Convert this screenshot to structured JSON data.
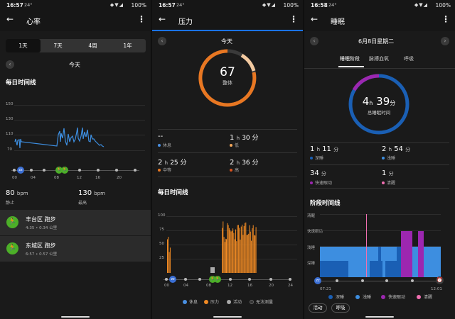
{
  "status": {
    "time1": "16:57",
    "time2": "16:57",
    "time3": "16:58",
    "temp": "24°",
    "battery": "100%"
  },
  "hr": {
    "title": "心率",
    "ranges": [
      "1天",
      "7天",
      "4周",
      "1年"
    ],
    "day": "今天",
    "timeline_title": "每日时间线",
    "ticks_y": [
      "150",
      "130",
      "110",
      "70"
    ],
    "ticks_x": [
      "00",
      "04",
      "08",
      "12",
      "16",
      "20"
    ],
    "rest_value": "80",
    "rest_unit": "bpm",
    "rest_label": "静止",
    "max_value": "130",
    "max_unit": "bpm",
    "max_label": "最高",
    "activities": [
      {
        "title": "丰台区 跑步",
        "sub": "4:35 • 0.34 公里"
      },
      {
        "title": "东城区 跑步",
        "sub": "6:57 • 0.57 公里"
      }
    ]
  },
  "stress": {
    "title": "压力",
    "day": "今天",
    "overall_value": "67",
    "overall_label": "整体",
    "stats": [
      {
        "value": "--",
        "h": "",
        "m": "",
        "label": "休息",
        "color": "#4a90e2"
      },
      {
        "value": "1",
        "h": "h",
        "m": "30 分",
        "label": "低",
        "color": "#f2a65a"
      },
      {
        "value": "2",
        "h": "h",
        "m": "25 分",
        "label": "中等",
        "color": "#e87722"
      },
      {
        "value": "2",
        "h": "h",
        "m": "36 分",
        "label": "高",
        "color": "#d9531e"
      }
    ],
    "timeline_title": "每日时间线",
    "ticks_y": [
      "100",
      "75",
      "50",
      "25"
    ],
    "ticks_x": [
      "00",
      "04",
      "08",
      "12",
      "16",
      "20",
      "24"
    ],
    "legend": [
      {
        "label": "休息",
        "color": "#4a90e2"
      },
      {
        "label": "压力",
        "color": "#f08a24"
      },
      {
        "label": "活动",
        "color": "#aaaaaa"
      },
      {
        "label": "无法测量",
        "color": "#333333"
      }
    ]
  },
  "sleep": {
    "title": "睡眠",
    "date": "6月8日星期二",
    "tabs": [
      "睡眠阶段",
      "脉搏血氧",
      "呼吸"
    ],
    "total_h": "4",
    "total_hu": "h",
    "total_m": "39",
    "total_mu": "分",
    "total_label": "总睡眠时间",
    "stats": [
      {
        "h": "1",
        "hu": "h",
        "m": "11",
        "mu": "分",
        "label": "深睡",
        "color": "#1a5fb4"
      },
      {
        "h": "2",
        "hu": "h",
        "m": "54",
        "mu": "分",
        "label": "浅睡",
        "color": "#3d8ee0"
      },
      {
        "h": "",
        "hu": "",
        "m": "34",
        "mu": "分",
        "label": "快速眼动",
        "color": "#9c27b0"
      },
      {
        "h": "",
        "hu": "",
        "m": "1",
        "mu": "分",
        "label": "清醒",
        "color": "#f06fb0"
      }
    ],
    "timeline_title": "阶段时间线",
    "levels": [
      "清醒",
      "快速眼动",
      "浅睡",
      "深睡"
    ],
    "start": "07:21",
    "end": "12:01",
    "legend": [
      {
        "label": "深睡",
        "color": "#1a5fb4"
      },
      {
        "label": "浅睡",
        "color": "#3d8ee0"
      },
      {
        "label": "快速眼动",
        "color": "#9c27b0"
      },
      {
        "label": "清醒",
        "color": "#f06fb0"
      }
    ],
    "chips": [
      "活动",
      "呼吸"
    ]
  }
}
